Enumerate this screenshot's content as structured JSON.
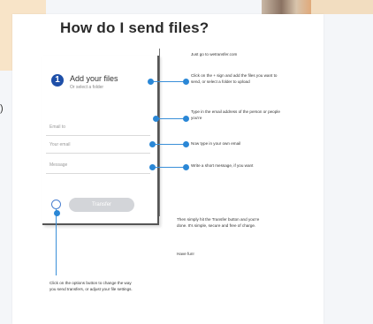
{
  "page": {
    "title": "How do I send files?",
    "edge_char": ")"
  },
  "panel": {
    "step_number": "1",
    "add_files_label": "Add your files",
    "add_files_sub": "Or select a folder",
    "fields": [
      {
        "placeholder": "Email to"
      },
      {
        "placeholder": "Your email"
      },
      {
        "placeholder": "Message"
      }
    ],
    "transfer_label": "Transfer"
  },
  "steps": [
    {
      "text": "Just go to wetransfer.com"
    },
    {
      "text": "Click on the + sign and add the files you want to send, or select a folder to upload"
    },
    {
      "text": "Type in the email address of the person or people you're"
    },
    {
      "text": "Now type in your own email"
    },
    {
      "text": "Write a short message, if you want"
    },
    {
      "text": "Then simply hit the Transfer button and you're done. It's simple, secure and free of charge."
    },
    {
      "text": "Have fun!"
    },
    {
      "text": "Click on the options button to change the way you send transfers, or adjust your file settings."
    }
  ],
  "colors": {
    "accent": "#2a87d6",
    "step_circle": "#1e4fa8",
    "button_disabled": "#d3d5d9"
  }
}
